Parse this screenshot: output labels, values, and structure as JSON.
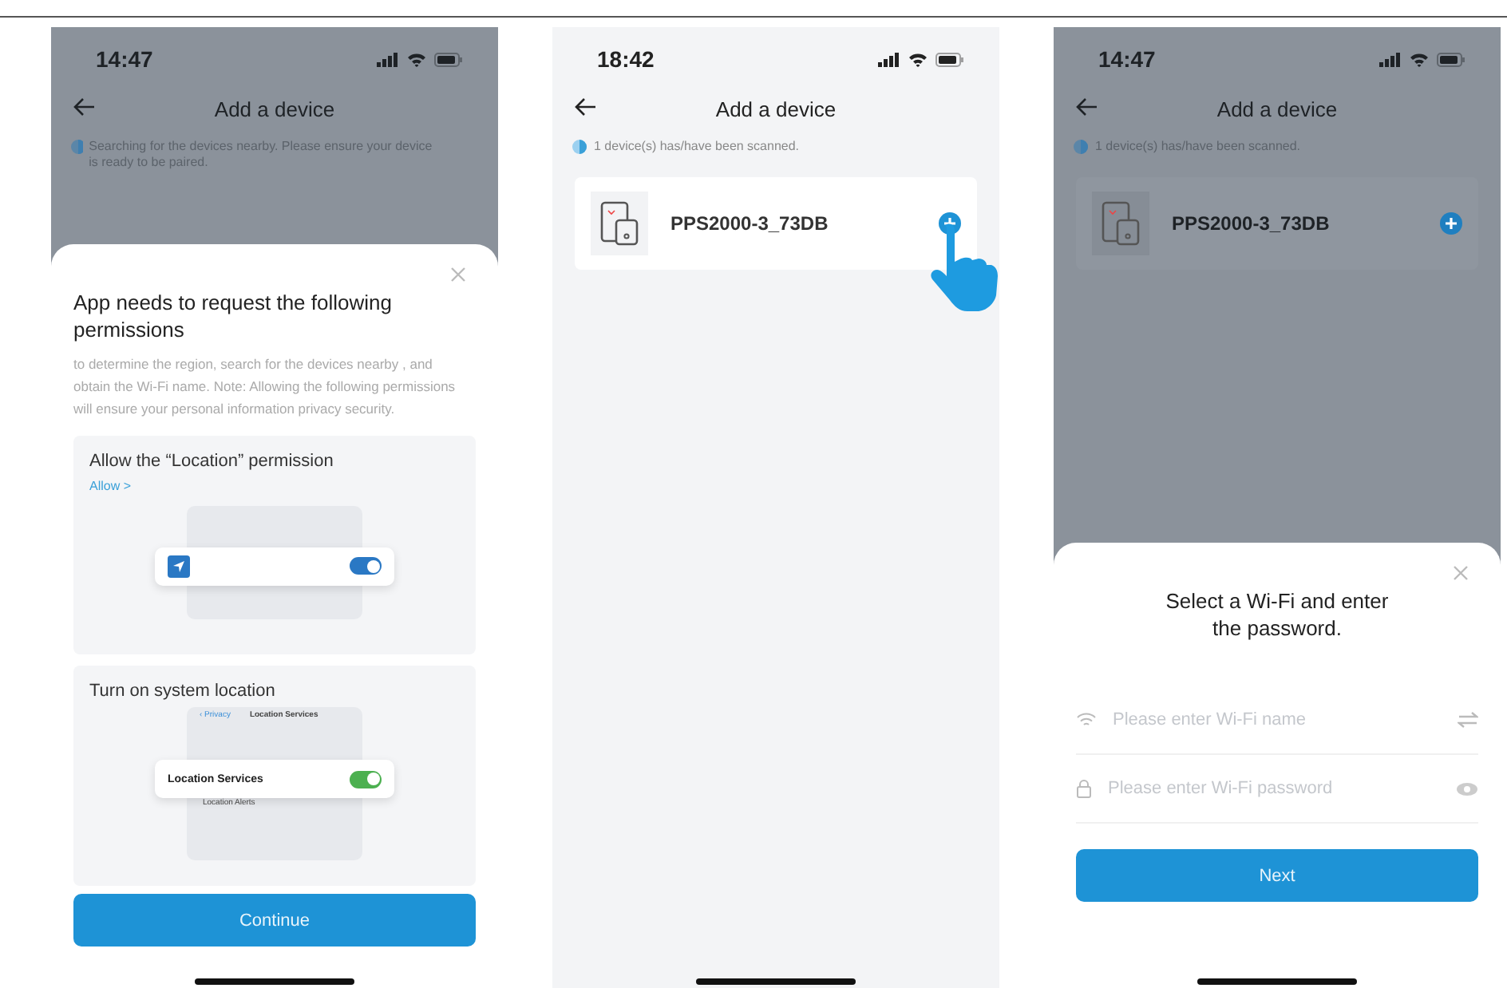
{
  "screens": [
    {
      "kind": "permissions",
      "dimmed": true,
      "time": "14:47",
      "title": "Add a device",
      "status": "Searching for the devices nearby. Please ensure your device is ready to be paired.",
      "sheet": {
        "title": "App needs to request the following permissions",
        "description": "to determine the region, search for the devices nearby , and obtain the Wi-Fi name. Note: Allowing the following permissions will ensure your personal information privacy security.",
        "cards": [
          {
            "kind": "app",
            "title": "Allow the “Location” permission",
            "link": "Allow >",
            "toggle_on": true
          },
          {
            "kind": "system",
            "title": "Turn on system location",
            "back": "‹ Privacy",
            "header": "Location Services",
            "row": "Location Services",
            "subrow": "Location Alerts",
            "toggle_on": true
          }
        ],
        "button": "Continue"
      }
    },
    {
      "kind": "devices",
      "dimmed": false,
      "time": "18:42",
      "title": "Add a device",
      "status": "1 device(s) has/have been scanned.",
      "devices": [
        {
          "name": "PPS2000-3_73DB"
        }
      ],
      "pointer": true
    },
    {
      "kind": "wifi",
      "dimmed": true,
      "time": "14:47",
      "title": "Add a device",
      "status": "1 device(s) has/have been scanned.",
      "devices": [
        {
          "name": "PPS2000-3_73DB"
        }
      ],
      "pointer": false,
      "sheet": {
        "title": "Select a Wi-Fi and enter the password.",
        "fields": [
          {
            "kind": "wifi",
            "placeholder": "Please enter Wi-Fi name"
          },
          {
            "kind": "password",
            "placeholder": "Please enter Wi-Fi password"
          }
        ],
        "button": "Next"
      }
    }
  ]
}
